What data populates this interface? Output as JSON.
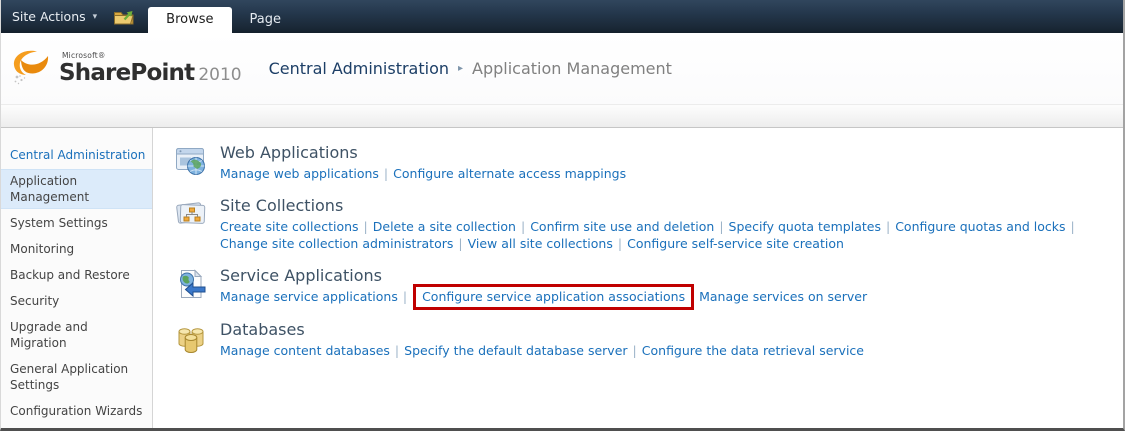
{
  "ui": {
    "link_separator": "|"
  },
  "colors": {
    "topbar_navy": "#22354a",
    "link_blue": "#1a70bb",
    "heading_slate": "#3e5265",
    "annotation_red": "#c00000",
    "selected_item_bg": "#dcebfa"
  },
  "topbar": {
    "site_actions": {
      "label": "Site Actions",
      "caret": "▾"
    },
    "navigate_up_icon": "folder-up-icon",
    "tabs": [
      {
        "label": "Browse",
        "active": true
      },
      {
        "label": "Page",
        "active": false
      }
    ]
  },
  "header": {
    "logo": {
      "icon": "sharepoint-swirl-icon",
      "microsoft": "Microsoft®",
      "product": "SharePoint",
      "year": "2010"
    },
    "breadcrumb": {
      "root": "Central Administration",
      "separator": "▸",
      "current": "Application Management"
    }
  },
  "sidebar": {
    "items": [
      {
        "label": "Central Administration",
        "style": "link"
      },
      {
        "label": "Application Management",
        "selected": true
      },
      {
        "label": "System Settings"
      },
      {
        "label": "Monitoring"
      },
      {
        "label": "Backup and Restore"
      },
      {
        "label": "Security"
      },
      {
        "label": "Upgrade and Migration"
      },
      {
        "label": "General Application Settings"
      },
      {
        "label": "Configuration Wizards"
      }
    ]
  },
  "sections": [
    {
      "title": "Web Applications",
      "icon": "web-applications-icon",
      "lines": [
        [
          {
            "label": "Manage web applications"
          },
          {
            "label": "Configure alternate access mappings"
          }
        ]
      ]
    },
    {
      "title": "Site Collections",
      "icon": "site-collections-icon",
      "lines": [
        [
          {
            "label": "Create site collections"
          },
          {
            "label": "Delete a site collection"
          },
          {
            "label": "Confirm site use and deletion"
          },
          {
            "label": "Specify quota templates"
          },
          {
            "label": "Configure quotas and locks"
          }
        ],
        [
          {
            "label": "Change site collection administrators"
          },
          {
            "label": "View all site collections"
          },
          {
            "label": "Configure self-service site creation"
          }
        ]
      ]
    },
    {
      "title": "Service Applications",
      "icon": "service-applications-icon",
      "lines": [
        [
          {
            "label": "Manage service applications"
          },
          {
            "label": "Configure service application associations",
            "annotated": true
          },
          {
            "label": "Manage services on server"
          }
        ]
      ]
    },
    {
      "title": "Databases",
      "icon": "databases-icon",
      "lines": [
        [
          {
            "label": "Manage content databases"
          },
          {
            "label": "Specify the default database server"
          },
          {
            "label": "Configure the data retrieval service"
          }
        ]
      ]
    }
  ]
}
